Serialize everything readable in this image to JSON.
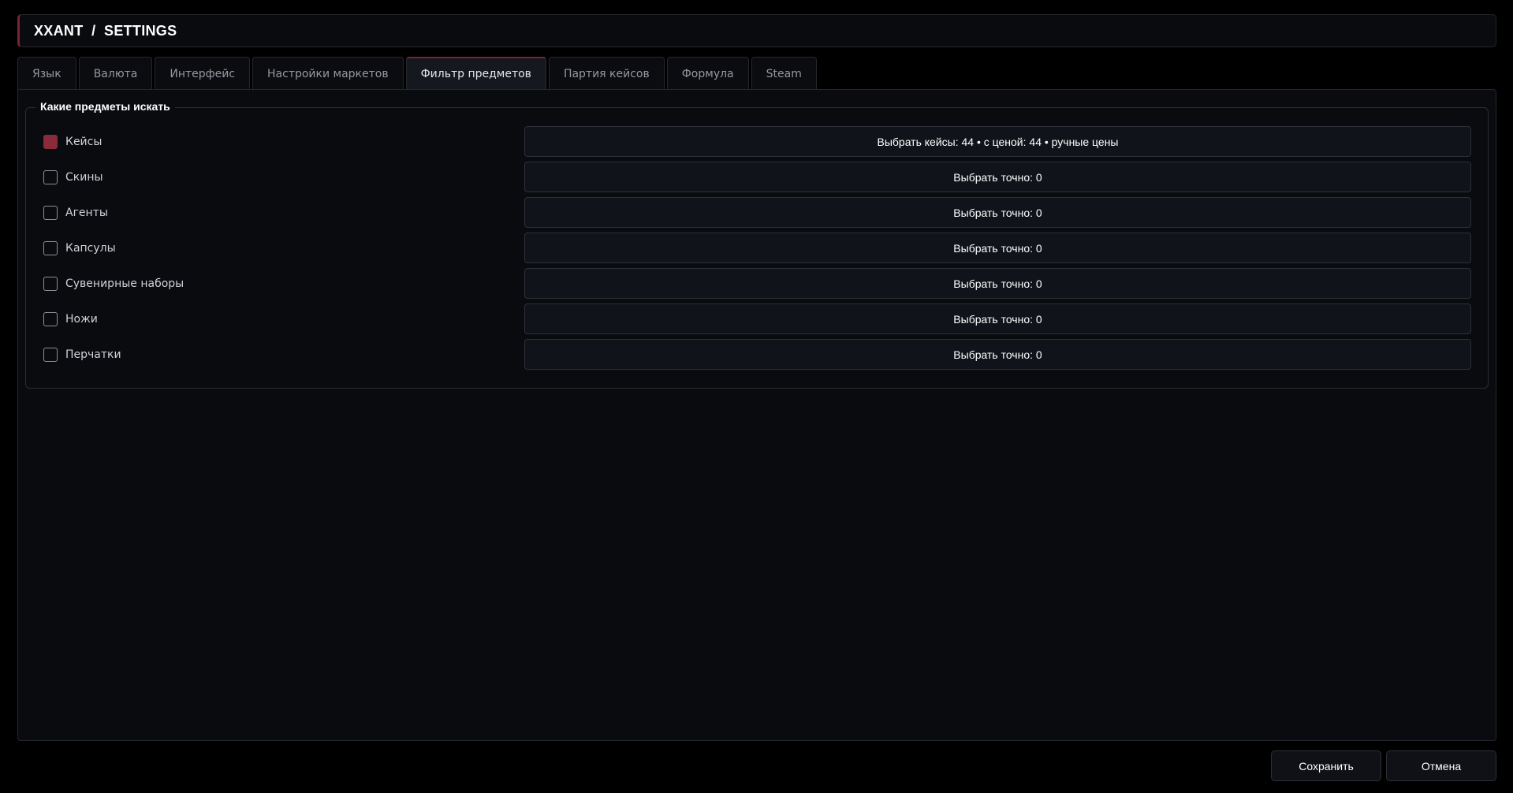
{
  "header": {
    "title": "XXANT  /  SETTINGS"
  },
  "tabs": [
    {
      "label": "Язык"
    },
    {
      "label": "Валюта"
    },
    {
      "label": "Интерфейс"
    },
    {
      "label": "Настройки маркетов"
    },
    {
      "label": "Фильтр предметов",
      "active": true
    },
    {
      "label": "Партия кейсов"
    },
    {
      "label": "Формула"
    },
    {
      "label": "Steam"
    }
  ],
  "group": {
    "title": "Какие предметы искать",
    "items": [
      {
        "label": "Кейсы",
        "checked": true,
        "button": "Выбрать кейсы: 44 • с ценой: 44 • ручные цены"
      },
      {
        "label": "Скины",
        "checked": false,
        "button": "Выбрать точно: 0"
      },
      {
        "label": "Агенты",
        "checked": false,
        "button": "Выбрать точно: 0"
      },
      {
        "label": "Капсулы",
        "checked": false,
        "button": "Выбрать точно: 0"
      },
      {
        "label": "Сувенирные наборы",
        "checked": false,
        "button": "Выбрать точно: 0"
      },
      {
        "label": "Ножи",
        "checked": false,
        "button": "Выбрать точно: 0"
      },
      {
        "label": "Перчатки",
        "checked": false,
        "button": "Выбрать точно: 0"
      }
    ]
  },
  "footer": {
    "save_label": "Сохранить",
    "cancel_label": "Отмена"
  },
  "colors": {
    "accent": "#8b2a3a",
    "background": "#000000",
    "panel": "#0a0b0f"
  }
}
